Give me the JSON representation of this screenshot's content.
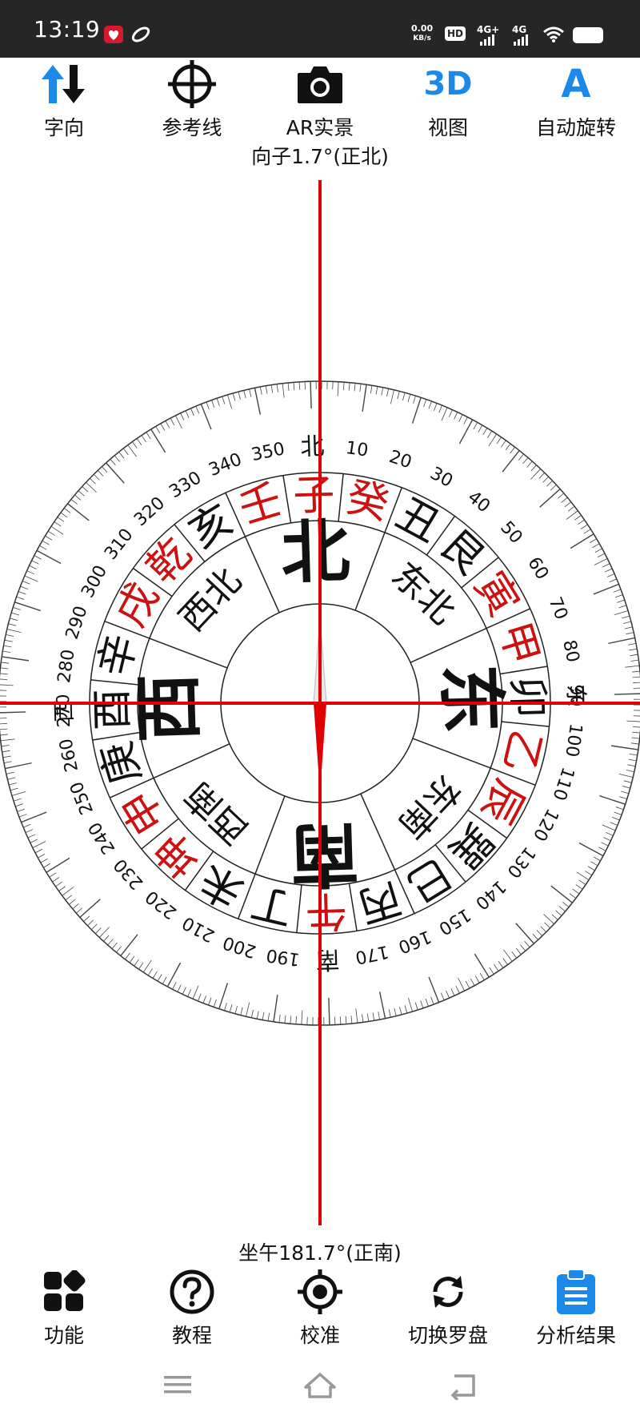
{
  "status_bar": {
    "time": "13:19",
    "net_speed_value": "0.00",
    "net_speed_unit": "KB/s",
    "hd_badge": "HD",
    "signal_1": "4G+",
    "signal_2": "4G"
  },
  "top_toolbar": [
    {
      "id": "direction",
      "label": "字向",
      "icon": "up-down-arrows-icon"
    },
    {
      "id": "reference",
      "label": "参考线",
      "icon": "crosshair-icon"
    },
    {
      "id": "ar",
      "label": "AR实景",
      "icon": "camera-icon"
    },
    {
      "id": "view",
      "label": "视图",
      "icon": "3d-icon",
      "icon_text": "3D"
    },
    {
      "id": "autorotate",
      "label": "自动旋转",
      "icon": "letter-a-icon",
      "icon_text": "A"
    }
  ],
  "facing": "向子1.7°(正北)",
  "sitting": "坐午181.7°(正南)",
  "compass": {
    "rotation_deg": 1.7,
    "degree_labels": [
      "10",
      "20",
      "30",
      "40",
      "50",
      "60",
      "70",
      "80",
      "90",
      "100",
      "110",
      "120",
      "130",
      "140",
      "150",
      "160",
      "170",
      "190",
      "200",
      "210",
      "220",
      "230",
      "240",
      "250",
      "260",
      "270",
      "280",
      "290",
      "300",
      "310",
      "320",
      "330",
      "340",
      "350"
    ],
    "cardinal_north": "北",
    "cardinal_south": "南",
    "cardinal_east": "东",
    "cardinal_west": "西",
    "mountains": [
      {
        "name": "子",
        "red": true
      },
      {
        "name": "癸",
        "red": true
      },
      {
        "name": "丑",
        "red": false
      },
      {
        "name": "艮",
        "red": false
      },
      {
        "name": "寅",
        "red": true
      },
      {
        "name": "甲",
        "red": true
      },
      {
        "name": "卯",
        "red": false
      },
      {
        "name": "乙",
        "red": true
      },
      {
        "name": "辰",
        "red": true
      },
      {
        "name": "巽",
        "red": false
      },
      {
        "name": "巳",
        "red": false
      },
      {
        "name": "丙",
        "red": false
      },
      {
        "name": "午",
        "red": true
      },
      {
        "name": "丁",
        "red": false
      },
      {
        "name": "未",
        "red": false
      },
      {
        "name": "坤",
        "red": true
      },
      {
        "name": "申",
        "red": true
      },
      {
        "name": "庚",
        "red": false
      },
      {
        "name": "酉",
        "red": false
      },
      {
        "name": "辛",
        "red": false
      },
      {
        "name": "戌",
        "red": true
      },
      {
        "name": "乾",
        "red": true
      },
      {
        "name": "亥",
        "red": false
      },
      {
        "name": "壬",
        "red": true
      }
    ],
    "directions": [
      {
        "name": "北",
        "big": true
      },
      {
        "name": "东北",
        "big": false
      },
      {
        "name": "东",
        "big": true
      },
      {
        "name": "东南",
        "big": false
      },
      {
        "name": "南",
        "big": true
      },
      {
        "name": "西南",
        "big": false
      },
      {
        "name": "西",
        "big": true
      },
      {
        "name": "西北",
        "big": false
      }
    ],
    "colors": {
      "red": "#cc1111",
      "black": "#111111",
      "crosshair": "#e00000"
    }
  },
  "bottom_toolbar": [
    {
      "id": "functions",
      "label": "功能",
      "icon": "grid-icon",
      "active": false
    },
    {
      "id": "tutorial",
      "label": "教程",
      "icon": "question-icon",
      "active": false
    },
    {
      "id": "calibrate",
      "label": "校准",
      "icon": "target-icon",
      "active": false
    },
    {
      "id": "switch",
      "label": "切换罗盘",
      "icon": "refresh-icon",
      "active": false
    },
    {
      "id": "analysis",
      "label": "分析结果",
      "icon": "clipboard-icon",
      "active": true
    }
  ],
  "colors": {
    "accent": "#1c89e8",
    "status_bar": "#262626"
  }
}
